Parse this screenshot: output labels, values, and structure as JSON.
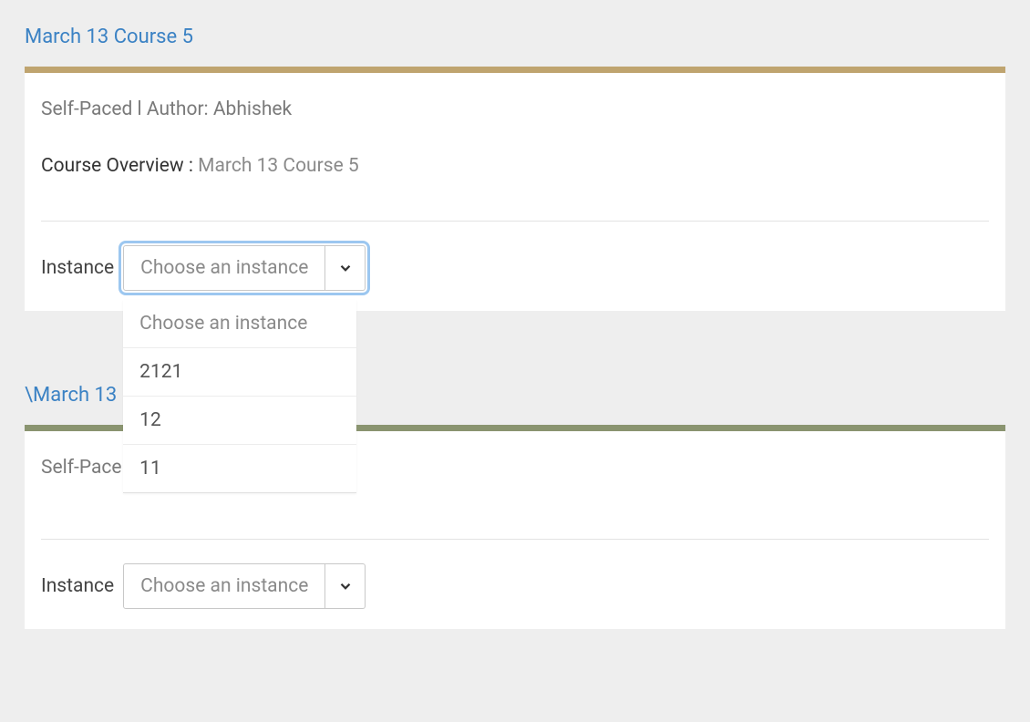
{
  "course1": {
    "title": "March 13 Course 5",
    "meta": "Self-Paced l Author: Abhishek",
    "overviewLabel": "Course Overview : ",
    "overviewValue": "March 13 Course 5",
    "instanceLabel": "Instance",
    "selectText": "Choose an instance",
    "dropdown": {
      "placeholder": "Choose an instance",
      "opt1": "2121",
      "opt2": "12",
      "opt3": "11"
    }
  },
  "course2": {
    "title": "\\March 13 C",
    "meta": "Self-Pace",
    "instanceLabel": "Instance",
    "selectText": "Choose an instance"
  }
}
